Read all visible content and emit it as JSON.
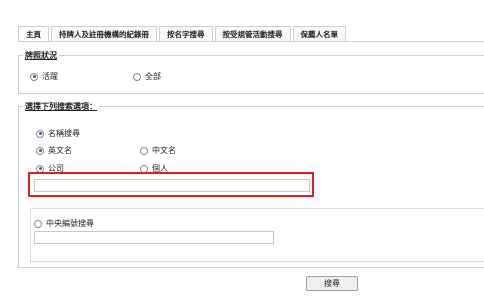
{
  "tabs": [
    "主頁",
    "持牌人及註冊機構的紀錄冊",
    "按名字搜尋",
    "按受規管活動搜尋",
    "保薦人名單"
  ],
  "status_section": {
    "legend": "牌照狀況",
    "options": [
      {
        "label": "活躍",
        "checked": true
      },
      {
        "label": "全部",
        "checked": false
      }
    ]
  },
  "options_section": {
    "legend": "選擇下列搜索選項：",
    "name_search": {
      "label": "名稱搜尋",
      "checked": true
    },
    "english_name": {
      "label": "英文名",
      "checked": true
    },
    "chinese_name": {
      "label": "中文名",
      "checked": false
    },
    "company": {
      "label": "公司",
      "checked": true
    },
    "individual": {
      "label": "個人",
      "checked": false
    },
    "name_input_value": "",
    "central_number": {
      "label": "中央編號搜尋",
      "checked": false
    },
    "central_input_value": ""
  },
  "search_button": "搜尋"
}
